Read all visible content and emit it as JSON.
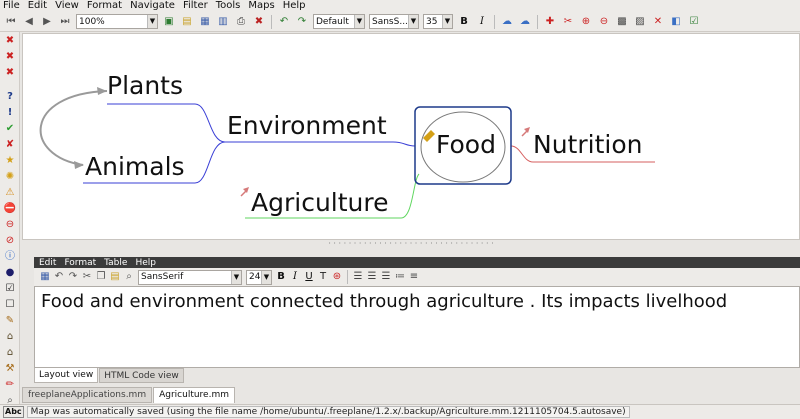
{
  "menus": [
    "File",
    "Edit",
    "View",
    "Format",
    "Navigate",
    "Filter",
    "Tools",
    "Maps",
    "Help"
  ],
  "toolbar": {
    "zoom": "100%",
    "style": "Default",
    "font": "SansS...",
    "size": "35",
    "bold": "B",
    "italic": "I"
  },
  "map": {
    "center": "Food",
    "nodes": {
      "environment": "Environment",
      "plants": "Plants",
      "animals": "Animals",
      "agriculture": "Agriculture",
      "nutrition": "Nutrition"
    },
    "colors": {
      "environment_edge": "#3a3fd6",
      "agriculture_edge": "#5fd65f",
      "nutrition_edge": "#d65f5f",
      "center_border": "#1d3a8a",
      "connector": "#9a9a9a"
    }
  },
  "note": {
    "menus": [
      "Edit",
      "Format",
      "Table",
      "Help"
    ],
    "font": "SansSerif",
    "size": "24",
    "text": "Food and environment connected through agriculture . Its impacts livelhood",
    "tabs": [
      "Layout view",
      "HTML Code view"
    ]
  },
  "map_tabs": [
    "freeplaneApplications.mm",
    "Agriculture.mm"
  ],
  "status": {
    "indicator": "Abc",
    "message": "Map was automatically saved (using the file name /home/ubuntu/.freeplane/1.2.x/.backup/Agriculture.mm.1211105704.5.autosave)"
  }
}
